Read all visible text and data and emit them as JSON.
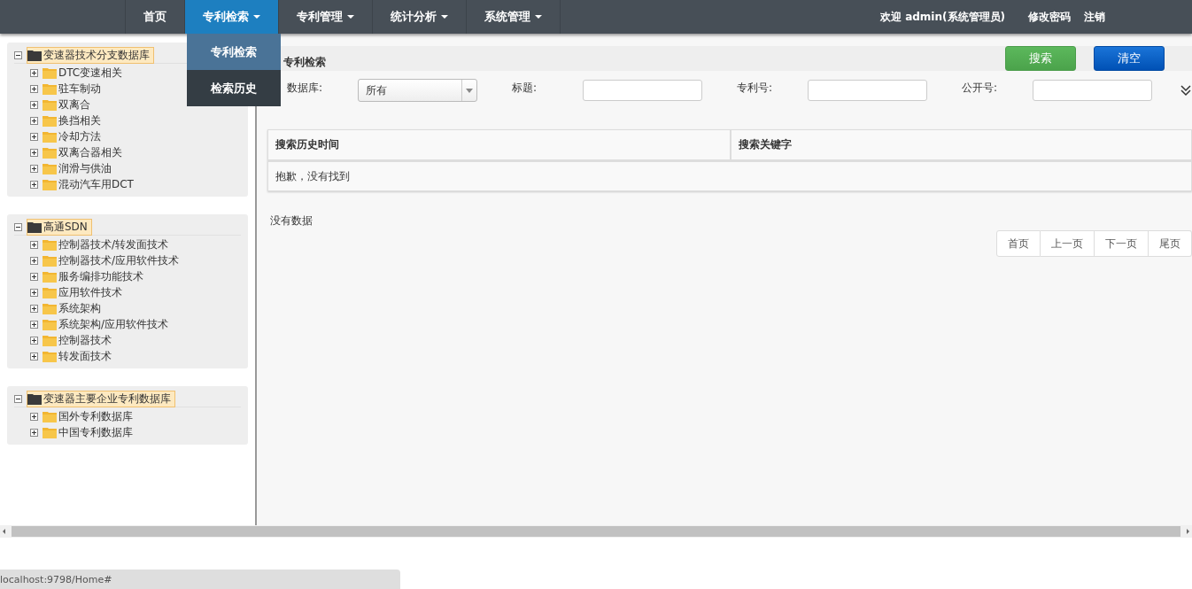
{
  "nav": {
    "items": [
      {
        "label": "首页",
        "selected": false,
        "has_caret": false
      },
      {
        "label": "专利检索",
        "selected": true,
        "has_caret": true
      },
      {
        "label": "专利管理",
        "selected": false,
        "has_caret": true
      },
      {
        "label": "统计分析",
        "selected": false,
        "has_caret": true
      },
      {
        "label": "系统管理",
        "selected": false,
        "has_caret": true
      }
    ],
    "dropdown": [
      {
        "label": "专利检索",
        "selected": true
      },
      {
        "label": "检索历史",
        "selected": false
      }
    ],
    "welcome": "欢迎 admin(系统管理员)",
    "links": [
      "修改密码",
      "注销"
    ]
  },
  "sidebar": {
    "trees": [
      {
        "label": "变速器技术分支数据库",
        "expanded": true,
        "children": [
          {
            "label": "DTC变速相关",
            "expanded": false
          },
          {
            "label": "驻车制动",
            "expanded": false
          },
          {
            "label": "双离合",
            "expanded": false
          },
          {
            "label": "换挡相关",
            "expanded": false
          },
          {
            "label": "冷却方法",
            "expanded": false
          },
          {
            "label": "双离合器相关",
            "expanded": false
          },
          {
            "label": "润滑与供油",
            "expanded": false
          },
          {
            "label": "混动汽车用DCT",
            "expanded": false
          }
        ]
      },
      {
        "label": "高通SDN",
        "expanded": true,
        "children": [
          {
            "label": "控制器技术/转发面技术",
            "expanded": false
          },
          {
            "label": "控制器技术/应用软件技术",
            "expanded": false
          },
          {
            "label": "服务编排功能技术",
            "expanded": false
          },
          {
            "label": "应用软件技术",
            "expanded": false
          },
          {
            "label": "系统架构",
            "expanded": false
          },
          {
            "label": "系统架构/应用软件技术",
            "expanded": false
          },
          {
            "label": "控制器技术",
            "expanded": false
          },
          {
            "label": "转发面技术",
            "expanded": false
          }
        ]
      },
      {
        "label": "变速器主要企业专利数据库",
        "expanded": true,
        "children": [
          {
            "label": "国外专利数据库",
            "expanded": false
          },
          {
            "label": "中国专利数据库",
            "expanded": false
          }
        ]
      }
    ]
  },
  "search": {
    "title": "专利检索",
    "buttons": [
      {
        "label": "搜索",
        "kind": "search"
      },
      {
        "label": "清空",
        "kind": "clear"
      }
    ],
    "fields": [
      {
        "label": "数据库:",
        "kind": "select",
        "value": "所有"
      },
      {
        "label": "标题:",
        "kind": "text"
      },
      {
        "label": "专利号:",
        "kind": "text"
      },
      {
        "label": "公开号:",
        "kind": "text"
      }
    ]
  },
  "table": {
    "columns": [
      "搜索历史时间",
      "搜索关键字"
    ],
    "empty_message": "抱歉，没有找到"
  },
  "no_data": "没有数据",
  "pagination": [
    "首页",
    "上一页",
    "下一页",
    "尾页"
  ],
  "status_bar": "localhost:9798/Home#"
}
